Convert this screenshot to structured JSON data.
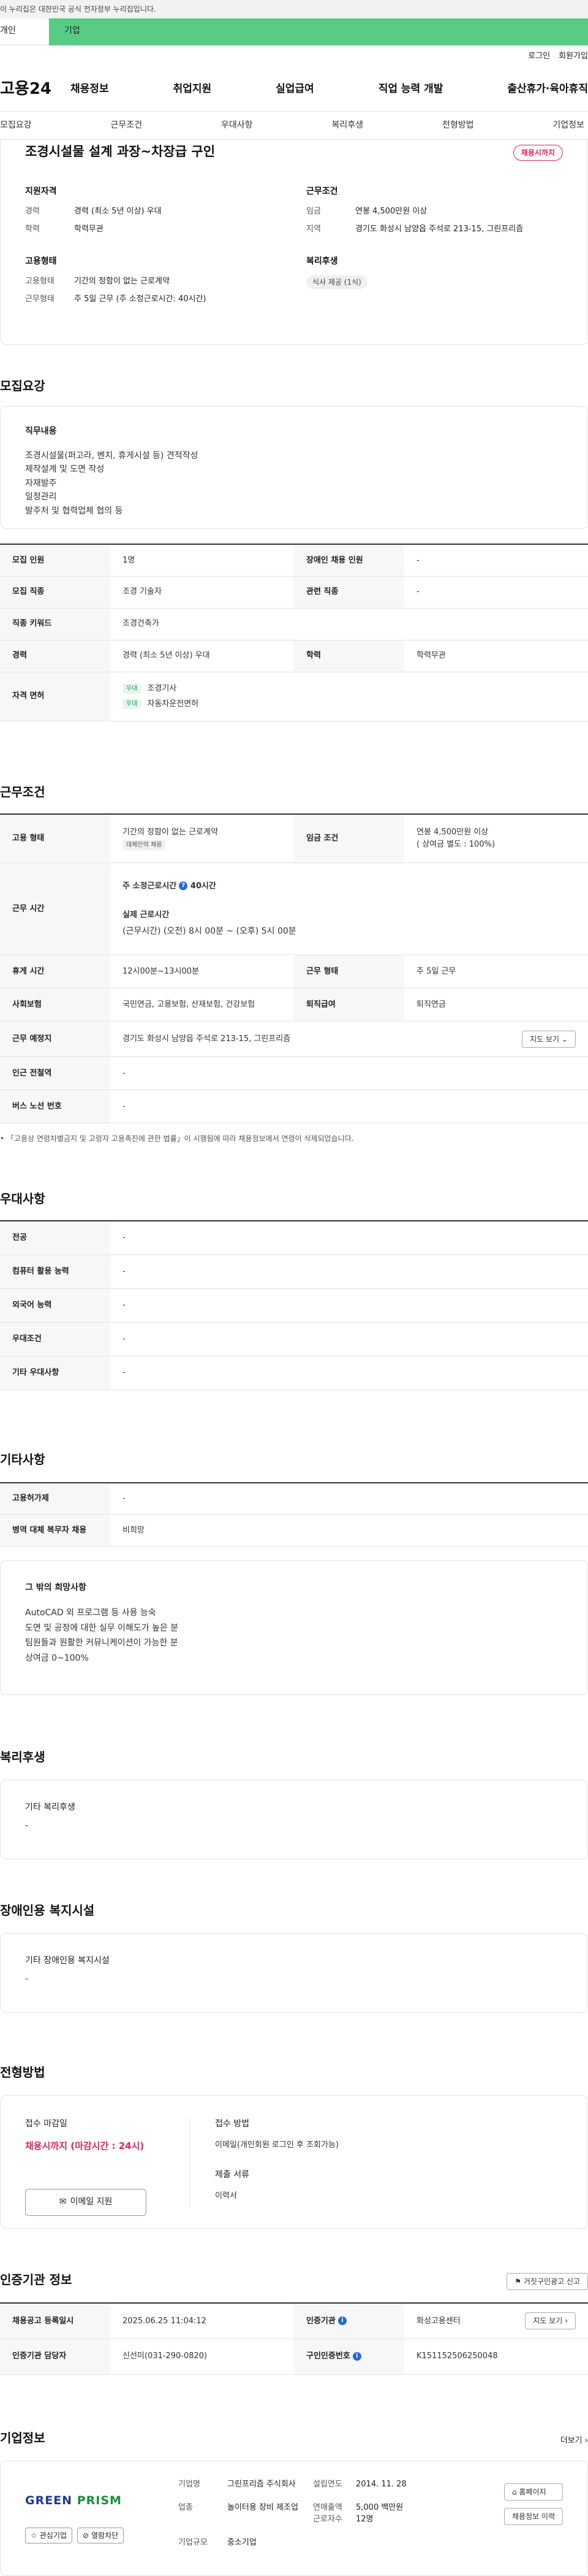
{
  "gov_banner": "이 누리집은 대한민국 공식 전자정부 누리집입니다.",
  "audience_tabs": {
    "person": "개인",
    "company": "기업"
  },
  "util_links": {
    "login": "로그인",
    "join": "회원가입"
  },
  "gnb": {
    "logo": "고용24",
    "menu": [
      "채용정보",
      "취업지원",
      "실업급여",
      "직업 능력 개발",
      "출산휴가·육아휴직"
    ]
  },
  "anchor_nav": [
    "모집요강",
    "근무조건",
    "우대사항",
    "복리후생",
    "전형방법",
    "기업정보"
  ],
  "summary": {
    "title": "조경시설물 설계 과장~차장급 구인",
    "status": "채용시까지",
    "qualification": {
      "heading": "지원자격",
      "rows": [
        {
          "k": "경력",
          "v": "경력 (최소 5년 이상) 우대"
        },
        {
          "k": "학력",
          "v": "학력무관"
        }
      ]
    },
    "conditions": {
      "heading": "근무조건",
      "rows": [
        {
          "k": "임금",
          "v": "연봉 4,500만원 이상"
        },
        {
          "k": "지역",
          "v": "경기도 화성시 남양읍 주석로 213-15, 그린프리즘"
        }
      ]
    },
    "employment": {
      "heading": "고용형태",
      "rows": [
        {
          "k": "고용형태",
          "v": "기간의 정함이 없는 근로계약"
        },
        {
          "k": "근무형태",
          "v": "주 5일 근무 (주 소정근로시간: 40시간)"
        }
      ]
    },
    "welfare": {
      "heading": "복리후생",
      "chip": "식사 제공 (1식)"
    }
  },
  "recruit": {
    "title": "모집요강",
    "duties_heading": "직무내용",
    "duties": [
      "조경시설물(퍼고라, 벤치, 휴게시설 등) 견적작성",
      "제작설계 및 도면 작성",
      "자재발주",
      "일정관리",
      "발주처 및 협력업체 협의 등"
    ],
    "rows": {
      "headcount": {
        "k": "모집 인원",
        "v": "1명"
      },
      "disabled": {
        "k": "장애인 채용 인원",
        "v": "-"
      },
      "job": {
        "k": "모집 직종",
        "v": "조경 기술자"
      },
      "related": {
        "k": "관련 직종",
        "v": "-"
      },
      "keyword": {
        "k": "직종 키워드",
        "v": "조경건축가"
      },
      "career": {
        "k": "경력",
        "v": "경력 (최소 5년 이상) 우대"
      },
      "edu": {
        "k": "학력",
        "v": "학력무관"
      },
      "license": {
        "k": "자격 면허",
        "tag": "우대",
        "items": [
          "조경기사",
          "자동차운전면허"
        ]
      }
    }
  },
  "work": {
    "title": "근무조건",
    "emp_type": {
      "k": "고용 형태",
      "v": "기간의 정함이 없는 근로계약",
      "tag": "대체인력 채용"
    },
    "wage": {
      "k": "임금 조건",
      "v": "연봉 4,500만원 이상",
      "sub": "( 상여금 별도 : 100%)"
    },
    "hours": {
      "k": "근무 시간",
      "weekly_label": "주 소정근로시간",
      "weekly_value": "40시간",
      "actual_label": "실제 근로시간",
      "actual_value": "(근무시간) (오전) 8시 00분 ~ (오후) 5시 00분"
    },
    "break": {
      "k": "휴게 시간",
      "v": "12시00분~13시00분"
    },
    "shift": {
      "k": "근무 형태",
      "v": "주 5일 근무"
    },
    "insurance": {
      "k": "사회보험",
      "v": "국민연금, 고용보험, 산재보험, 건강보험"
    },
    "retire": {
      "k": "퇴직급여",
      "v": "퇴직연금"
    },
    "place": {
      "k": "근무 예정지",
      "v": "경기도 화성시 남양읍 주석로 213-15, 그린프리즘",
      "btn": "지도 보기"
    },
    "subway": {
      "k": "인근 전철역",
      "v": "-"
    },
    "bus": {
      "k": "버스 노선 번호",
      "v": "-"
    },
    "note": "「고용상 연령차별금지 및 고령자 고용촉진에 관한 법률」이 시행됨에 따라 채용정보에서 연령이 삭제되었습니다."
  },
  "pref": {
    "title": "우대사항",
    "rows": [
      {
        "k": "전공",
        "v": "-"
      },
      {
        "k": "컴퓨터 활용 능력",
        "v": "-"
      },
      {
        "k": "외국어 능력",
        "v": "-"
      },
      {
        "k": "우대조건",
        "v": "-"
      },
      {
        "k": "기타 우대사항",
        "v": "-"
      }
    ]
  },
  "etc": {
    "title": "기타사항",
    "rows": [
      {
        "k": "고용허가제",
        "v": "-"
      },
      {
        "k": "병역 대체 복무자 채용",
        "v": "비희망"
      }
    ],
    "wish_heading": "그 밖의 희망사항",
    "wish": [
      "AutoCAD 외 프로그램 등 사용 능숙",
      "도면 및 공정에 대한 실무 이해도가 높은 분",
      "팀원들과 원활한 커뮤니케이션이 가능한 분",
      "상여금 0~100%"
    ]
  },
  "welfare": {
    "title": "복리후생",
    "heading": "기타 복리후생",
    "v": "-"
  },
  "facility": {
    "title": "장애인용 복지시설",
    "heading": "기타 장애인용 복지시설",
    "v": "-"
  },
  "process": {
    "title": "전형방법",
    "deadline_heading": "접수 마감일",
    "deadline": "채용시까지 (마감시간 : 24시)",
    "email_btn": "이메일 지원",
    "method_heading": "접수 방법",
    "method": "이메일(개인회원 로그인 후 조회가능)",
    "docs_heading": "제출 서류",
    "docs": "이력서"
  },
  "cert": {
    "title": "인증기관 정보",
    "report_btn": "거짓구인광고 신고",
    "reg_date": {
      "k": "채용공고 등록일시",
      "v": "2025.06.25 11:04:12"
    },
    "agency": {
      "k": "인증기관",
      "v": "화성고용센터",
      "btn": "지도 보기"
    },
    "manager": {
      "k": "인증기관 담당자",
      "v": "신선미(031-290-0820)"
    },
    "job_no": {
      "k": "구인인증번호",
      "v": "K151152506250048"
    }
  },
  "company": {
    "title": "기업정보",
    "more": "더보기",
    "logo": {
      "a": "GREEN ",
      "b": "PRISM"
    },
    "fav_btn": "관심기업",
    "block_btn": "열람차단",
    "name_k": "기업명",
    "name_v": "그린프리즘 주식회사",
    "founded_k": "설립연도",
    "founded_v": "2014. 11. 28",
    "industry_k": "업종",
    "industry_v": "놀이터용 장비 제조업",
    "sales_k": "연매출액",
    "sales_v": "5,000 백만원",
    "staff_k": "근로자수",
    "staff_v": "12명",
    "size_k": "기업규모",
    "size_v": "중소기업",
    "homepage_btn": "홈페이지",
    "jobs_btn": "채용정보 이력"
  },
  "colors": {
    "accent_green": "#58cc85",
    "status_red": "#e0245e",
    "info_blue": "#2a67d8"
  }
}
